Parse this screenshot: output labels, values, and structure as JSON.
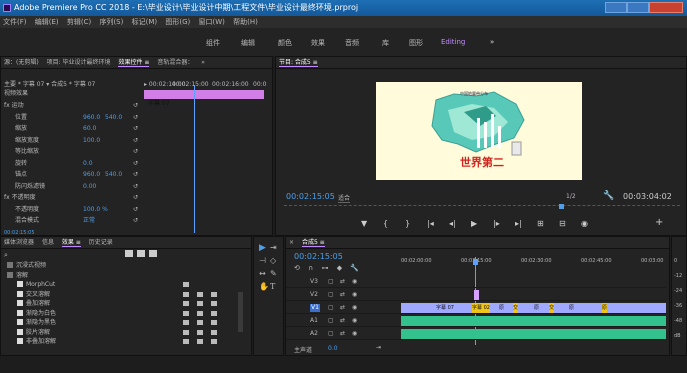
{
  "window": {
    "title": "Adobe Premiere Pro CC 2018 - E:\\毕业设计\\毕业设计中期\\工程文件\\毕业设计最终环境.prproj"
  },
  "menu": [
    "文件(F)",
    "编辑(E)",
    "剪辑(C)",
    "序列(S)",
    "标记(M)",
    "图形(G)",
    "窗口(W)",
    "帮助(H)"
  ],
  "workspaces": {
    "items": [
      "组件",
      "编辑",
      "颜色",
      "效果",
      "音频",
      "库",
      "图形"
    ],
    "active": "Editing",
    "more": "»"
  },
  "source_panel": {
    "tabs": [
      "源：(无剪辑)",
      "项目: 毕业设计最终环境",
      "效果控件 ≡",
      "音轨混合器：",
      "»"
    ],
    "header": "主要 * 字幕 07 ▾   合成5 * 字幕 07",
    "tc1": "▸ 00:02:14:00",
    "tc2": "00:02:15:00",
    "tc3": "00:02:16:00",
    "tc4": "00:0",
    "clip_label": "字幕 07",
    "video_fx": "视频效果",
    "rows": [
      {
        "label": "fx 运动",
        "v1": "",
        "v2": ""
      },
      {
        "label": "位置",
        "v1": "960.0",
        "v2": "540.0"
      },
      {
        "label": "缩放",
        "v1": "60.0",
        "v2": ""
      },
      {
        "label": "缩放宽度",
        "v1": "100.0",
        "v2": ""
      },
      {
        "label": "等比缩放",
        "v1": "",
        "v2": ""
      },
      {
        "label": "旋转",
        "v1": "0.0",
        "v2": ""
      },
      {
        "label": "锚点",
        "v1": "960.0",
        "v2": "540.0"
      },
      {
        "label": "防闪烁滤镜",
        "v1": "0.00",
        "v2": ""
      },
      {
        "label": "fx 不透明度",
        "v1": "",
        "v2": ""
      },
      {
        "label": "不透明度",
        "v1": "100.0 %",
        "v2": ""
      },
      {
        "label": "混合模式",
        "v1": "正常",
        "v2": ""
      }
    ],
    "footer_tc": "00:02:15:05"
  },
  "program": {
    "title": "节目: 合成5 ≡",
    "timecode": "00:02:15:05",
    "fit": "适合",
    "fraction": "1/2",
    "duration": "00:03:04:02",
    "frame": {
      "banner_label": "中国地震带分布",
      "headline": "世界第二"
    },
    "controls": [
      "marker-icon",
      "in-icon",
      "out-icon",
      "go-in-icon",
      "step-back-icon",
      "play-icon",
      "step-fwd-icon",
      "go-out-icon",
      "insert-icon",
      "overwrite-icon",
      "camera-icon"
    ]
  },
  "effects_panel": {
    "tabs": [
      "媒体浏览器",
      "信息",
      "效果 ≡",
      "历史记录"
    ],
    "items": [
      "沉浸式视频",
      "溶解",
      "MorphCut",
      "交叉溶解",
      "叠加溶解",
      "渐隐为白色",
      "渐隐为黑色",
      "胶片溶解",
      "非叠加溶解"
    ]
  },
  "timeline": {
    "tab": "合成5 ≡",
    "timecode": "00:02:15:05",
    "ruler": [
      "00:02:00:00",
      "00:02:15:00",
      "00:02:30:00",
      "00:02:45:00",
      "00:03:00"
    ],
    "tracks": [
      {
        "name": "V3"
      },
      {
        "name": "V2"
      },
      {
        "name": "V1"
      },
      {
        "name": "A1"
      },
      {
        "name": "A2"
      }
    ],
    "clips": [
      "字幕 07",
      "字幕 02",
      "原",
      "交",
      "原",
      "交",
      "原",
      "原"
    ],
    "master": "主声道",
    "master_val": "0.0",
    "meter": [
      "0",
      "-12",
      "-24",
      "-36",
      "-48",
      "dB"
    ]
  },
  "colors": {
    "accent": "#c38aff",
    "timecode_blue": "#4e9ee8",
    "playhead": "#5da0ff",
    "clip_video": "#9fa9ff",
    "clip_audio": "#33c28e"
  }
}
